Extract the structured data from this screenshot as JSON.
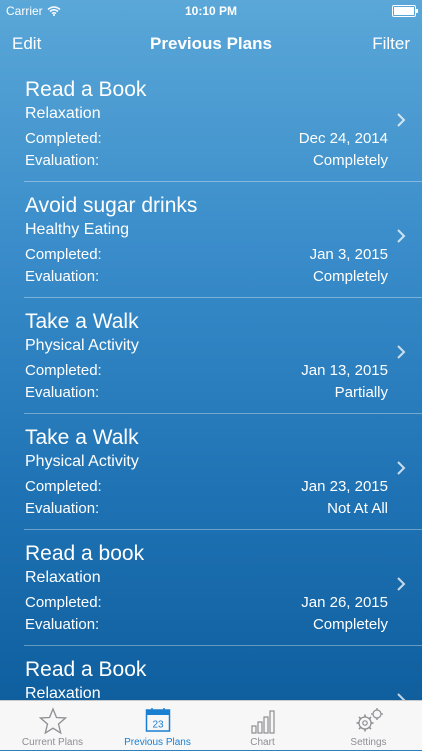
{
  "status_bar": {
    "carrier": "Carrier",
    "time": "10:10 PM"
  },
  "nav": {
    "left_label": "Edit",
    "title": "Previous Plans",
    "right_label": "Filter"
  },
  "plans": [
    {
      "title": "Read a Book",
      "category": "Relaxation",
      "completed_label": "Completed:",
      "completed": "Dec 24, 2014",
      "evaluation_label": "Evaluation:",
      "evaluation": "Completely"
    },
    {
      "title": "Avoid sugar drinks",
      "category": "Healthy Eating",
      "completed_label": "Completed:",
      "completed": "Jan 3, 2015",
      "evaluation_label": "Evaluation:",
      "evaluation": "Completely"
    },
    {
      "title": "Take a Walk",
      "category": "Physical Activity",
      "completed_label": "Completed:",
      "completed": "Jan 13, 2015",
      "evaluation_label": "Evaluation:",
      "evaluation": "Partially"
    },
    {
      "title": "Take a Walk",
      "category": "Physical Activity",
      "completed_label": "Completed:",
      "completed": "Jan 23, 2015",
      "evaluation_label": "Evaluation:",
      "evaluation": "Not At All"
    },
    {
      "title": "Read a  book",
      "category": "Relaxation",
      "completed_label": "Completed:",
      "completed": "Jan 26, 2015",
      "evaluation_label": "Evaluation:",
      "evaluation": "Completely"
    },
    {
      "title": "Read a Book",
      "category": "Relaxation",
      "completed_label": "",
      "completed": "",
      "evaluation_label": "",
      "evaluation": ""
    }
  ],
  "tabbar": {
    "tabs": [
      {
        "label": "Current Plans",
        "icon": "star-icon"
      },
      {
        "label": "Previous Plans",
        "icon": "calendar-icon",
        "icon_text": "23"
      },
      {
        "label": "Chart",
        "icon": "bar-chart-icon"
      },
      {
        "label": "Settings",
        "icon": "gear-icon"
      }
    ],
    "active_index": 1
  },
  "colors": {
    "accent": "#1a7fd0",
    "inactive": "#8e8e93",
    "background_top": "#5aa7d8",
    "background_bottom": "#0f5f9f"
  }
}
